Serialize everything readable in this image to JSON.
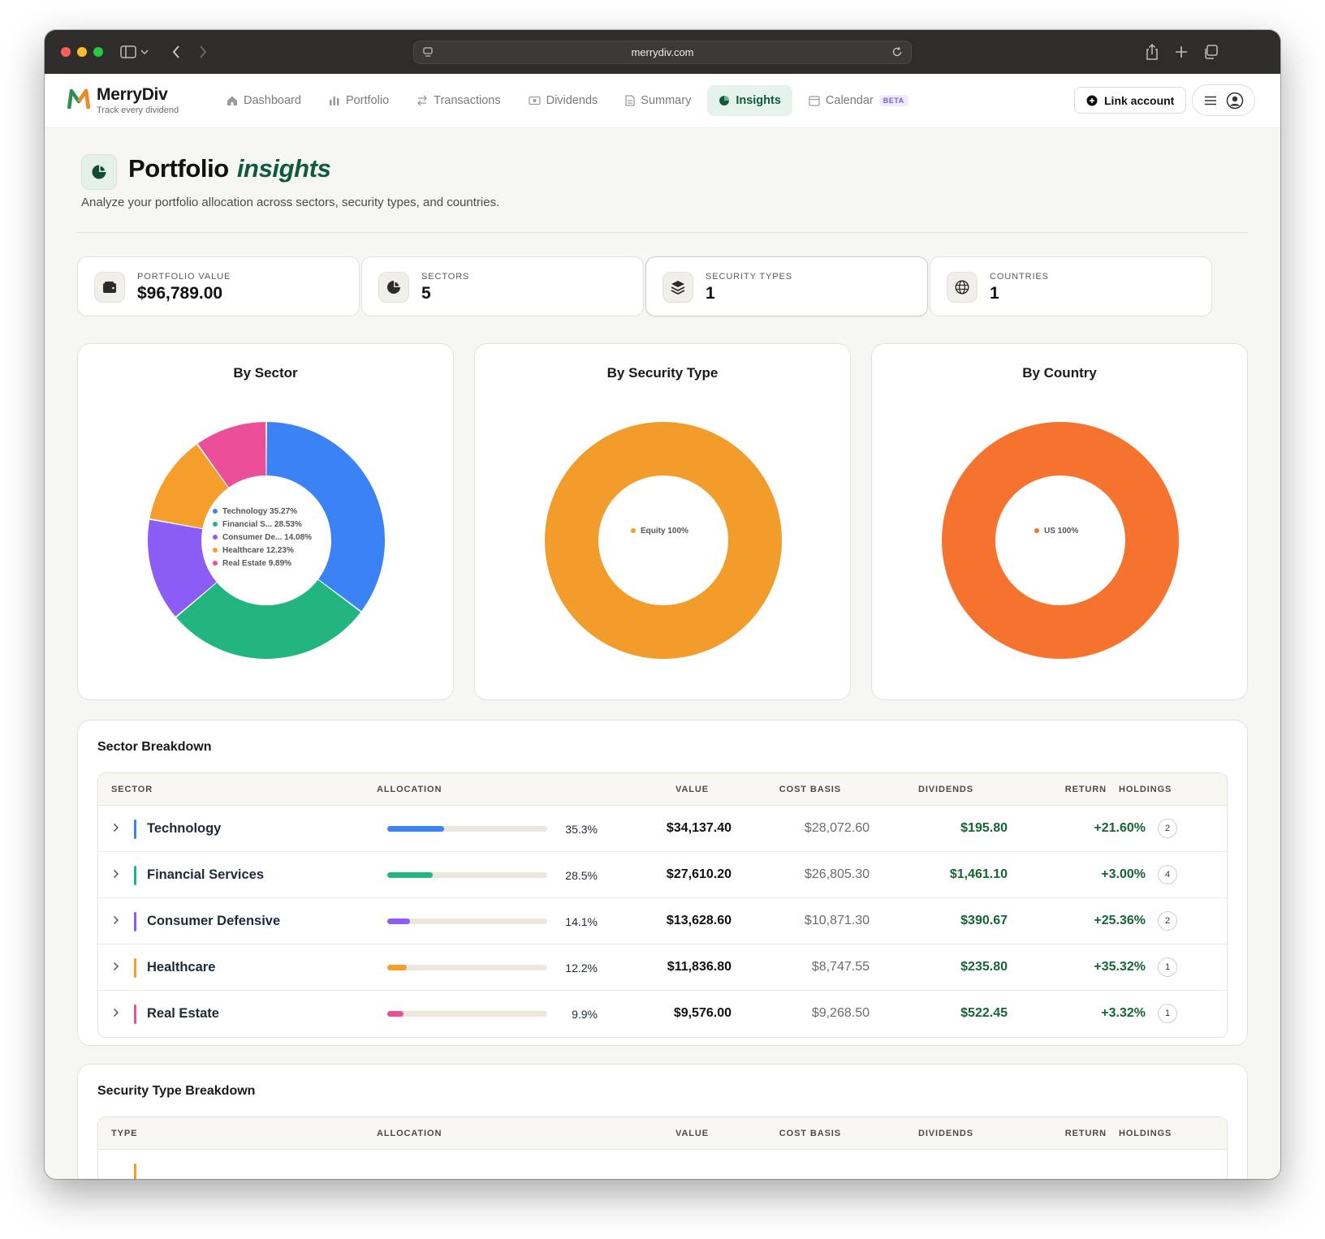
{
  "browser": {
    "url": "merrydiv.com"
  },
  "app": {
    "name": "MerryDiv",
    "tagline": "Track every dividend"
  },
  "nav": [
    {
      "label": "Dashboard",
      "icon": "home-icon"
    },
    {
      "label": "Portfolio",
      "icon": "bar-chart-icon"
    },
    {
      "label": "Transactions",
      "icon": "swap-icon"
    },
    {
      "label": "Dividends",
      "icon": "cash-icon"
    },
    {
      "label": "Summary",
      "icon": "document-icon"
    },
    {
      "label": "Insights",
      "icon": "pie-chart-icon",
      "active": true
    },
    {
      "label": "Calendar",
      "icon": "calendar-icon",
      "badge": "BETA"
    }
  ],
  "header": {
    "link_account": "Link account"
  },
  "page": {
    "title": "Portfolio",
    "title_accent": "insights",
    "subtitle": "Analyze your portfolio allocation across sectors, security types, and countries."
  },
  "stats": [
    {
      "label": "PORTFOLIO VALUE",
      "value": "$96,789.00",
      "icon": "wallet-icon"
    },
    {
      "label": "SECTORS",
      "value": "5",
      "icon": "pie-chart-icon"
    },
    {
      "label": "SECURITY TYPES",
      "value": "1",
      "icon": "layers-icon"
    },
    {
      "label": "COUNTRIES",
      "value": "1",
      "icon": "globe-icon"
    }
  ],
  "chart_data": [
    {
      "type": "pie",
      "title": "By Sector",
      "categories": [
        "Technology",
        "Financial Services",
        "Consumer Defensive",
        "Healthcare",
        "Real Estate"
      ],
      "values": [
        35.27,
        28.53,
        14.08,
        12.23,
        9.89
      ],
      "legend_labels": [
        "Technology 35.27%",
        "Financial S... 28.53%",
        "Consumer De... 14.08%",
        "Healthcare 12.23%",
        "Real Estate 9.89%"
      ],
      "colors": [
        "#3b82f6",
        "#22b57f",
        "#8b5cf6",
        "#f59e2b",
        "#ec4f9a"
      ],
      "legend_placement": "center"
    },
    {
      "type": "pie",
      "title": "By Security Type",
      "categories": [
        "Equity"
      ],
      "values": [
        100
      ],
      "legend_labels": [
        "Equity 100%"
      ],
      "colors": [
        "#f29d2b"
      ],
      "legend_placement": "center"
    },
    {
      "type": "pie",
      "title": "By Country",
      "categories": [
        "US"
      ],
      "values": [
        100
      ],
      "legend_labels": [
        "US 100%"
      ],
      "colors": [
        "#f5732e"
      ],
      "legend_placement": "center"
    }
  ],
  "sector_table": {
    "title": "Sector Breakdown",
    "headers": [
      "SECTOR",
      "ALLOCATION",
      "VALUE",
      "COST BASIS",
      "DIVIDENDS",
      "RETURN",
      "HOLDINGS"
    ],
    "rows": [
      {
        "name": "Technology",
        "color": "#3b82f6",
        "alloc": 35.3,
        "alloc_label": "35.3%",
        "value": "$34,137.40",
        "cost": "$28,072.60",
        "dividends": "$195.80",
        "return": "+21.60%",
        "holdings": "2"
      },
      {
        "name": "Financial Services",
        "color": "#22b57f",
        "alloc": 28.5,
        "alloc_label": "28.5%",
        "value": "$27,610.20",
        "cost": "$26,805.30",
        "dividends": "$1,461.10",
        "return": "+3.00%",
        "holdings": "4"
      },
      {
        "name": "Consumer Defensive",
        "color": "#8b5cf6",
        "alloc": 14.1,
        "alloc_label": "14.1%",
        "value": "$13,628.60",
        "cost": "$10,871.30",
        "dividends": "$390.67",
        "return": "+25.36%",
        "holdings": "2"
      },
      {
        "name": "Healthcare",
        "color": "#f59e2b",
        "alloc": 12.2,
        "alloc_label": "12.2%",
        "value": "$11,836.80",
        "cost": "$8,747.55",
        "dividends": "$235.80",
        "return": "+35.32%",
        "holdings": "1"
      },
      {
        "name": "Real Estate",
        "color": "#ec4f9a",
        "alloc": 9.9,
        "alloc_label": "9.9%",
        "value": "$9,576.00",
        "cost": "$9,268.50",
        "dividends": "$522.45",
        "return": "+3.32%",
        "holdings": "1"
      }
    ]
  },
  "security_table": {
    "title": "Security Type Breakdown",
    "headers": [
      "TYPE",
      "ALLOCATION",
      "VALUE",
      "COST BASIS",
      "DIVIDENDS",
      "RETURN",
      "HOLDINGS"
    ]
  }
}
